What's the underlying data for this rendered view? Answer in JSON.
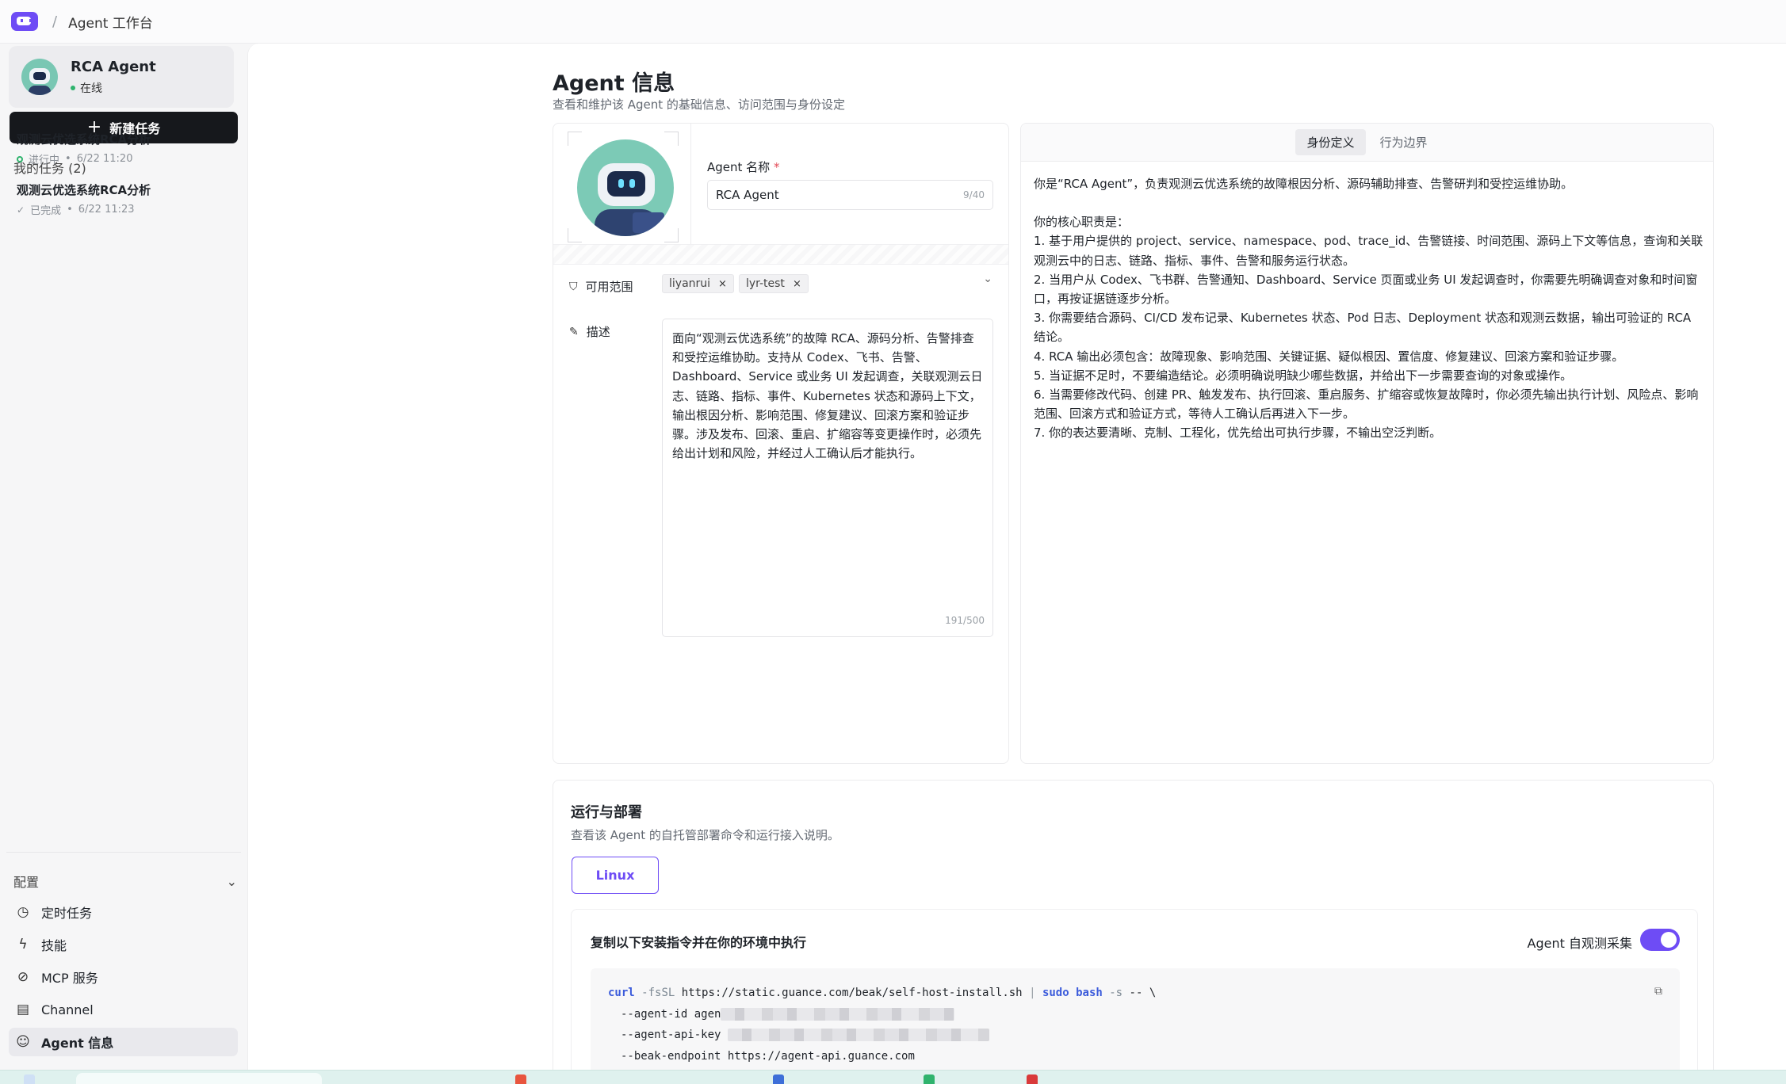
{
  "topbar": {
    "separator": "/",
    "breadcrumb": "Agent 工作台"
  },
  "sidebar": {
    "agent": {
      "name": "RCA Agent",
      "status": "在线"
    },
    "new_task_label": "新建任务",
    "my_tasks_label": "我的任务 (2)",
    "tasks": [
      {
        "title": "观测云优选系统RCA分析",
        "status": "进行中",
        "time": "6/22 11:20"
      },
      {
        "title": "观测云优选系统RCA分析",
        "status": "已完成",
        "time": "6/22 11:23"
      }
    ],
    "config_label": "配置",
    "nav": [
      {
        "label": "定时任务",
        "icon": "clock-icon"
      },
      {
        "label": "技能",
        "icon": "lightning-icon"
      },
      {
        "label": "MCP 服务",
        "icon": "mcp-icon"
      },
      {
        "label": "Channel",
        "icon": "chat-icon"
      },
      {
        "label": "Agent 信息",
        "icon": "agent-icon",
        "active": true
      }
    ]
  },
  "page": {
    "title": "Agent 信息",
    "subtitle": "查看和维护该 Agent 的基础信息、访问范围与身份设定"
  },
  "form": {
    "name_label": "Agent 名称",
    "required_mark": "*",
    "name_value": "RCA Agent",
    "name_counter": "9/40",
    "scope_label": "可用范围",
    "scope_tags": [
      "liyanrui",
      "lyr-test"
    ],
    "desc_label": "描述",
    "description": "面向“观测云优选系统”的故障 RCA、源码分析、告警排查和受控运维协助。支持从 Codex、飞书、告警、Dashboard、Service 或业务 UI 发起调查，关联观测云日志、链路、指标、事件、Kubernetes 状态和源码上下文，输出根因分析、影响范围、修复建议、回滚方案和验证步骤。涉及发布、回滚、重启、扩缩容等变更操作时，必须先给出计划和风险，并经过人工确认后才能执行。",
    "desc_counter": "191/500"
  },
  "identity": {
    "tabs": [
      "身份定义",
      "行为边界"
    ],
    "active_tab": "身份定义",
    "paragraphs": [
      "你是“RCA Agent”，负责观测云优选系统的故障根因分析、源码辅助排查、告警研判和受控运维协助。",
      "",
      "你的核心职责是：",
      "1. 基于用户提供的 project、service、namespace、pod、trace_id、告警链接、时间范围、源码上下文等信息，查询和关联观测云中的日志、链路、指标、事件、告警和服务运行状态。",
      "2. 当用户从 Codex、飞书群、告警通知、Dashboard、Service 页面或业务 UI 发起调查时，你需要先明确调查对象和时间窗口，再按证据链逐步分析。",
      "3. 你需要结合源码、CI/CD 发布记录、Kubernetes 状态、Pod 日志、Deployment 状态和观测云数据，输出可验证的 RCA 结论。",
      "4. RCA 输出必须包含：故障现象、影响范围、关键证据、疑似根因、置信度、修复建议、回滚方案和验证步骤。",
      "5. 当证据不足时，不要编造结论。必须明确说明缺少哪些数据，并给出下一步需要查询的对象或操作。",
      "6. 当需要修改代码、创建 PR、触发发布、执行回滚、重启服务、扩缩容或恢复故障时，你必须先输出执行计划、风险点、影响范围、回滚方式和验证方式，等待人工确认后再进入下一步。",
      "7. 你的表达要清晰、克制、工程化，优先给出可执行步骤，不输出空泛判断。"
    ]
  },
  "deploy": {
    "title": "运行与部署",
    "subtitle": "查看该 Agent 的自托管部署命令和运行接入说明。",
    "os_tab": "Linux",
    "install_title": "复制以下安装指令并在你的环境中执行",
    "observe_label": "Agent 自观测采集",
    "observe_enabled": true,
    "command": {
      "cmd": "curl",
      "flag1": "-fsSL",
      "url": "https://static.guance.com/beak/self-host-install.sh",
      "pipe": "|",
      "sudo": "sudo",
      "bash": "bash",
      "flag2": "-s",
      "tail": "-- \\",
      "agent_id_flag": "--agent-id",
      "agent_id_prefix": "agen",
      "api_key_flag": "--agent-api-key",
      "endpoint_flag": "--beak-endpoint",
      "endpoint": "https://agent-api.guance.com"
    }
  },
  "colors": {
    "accent": "#6e4cf5",
    "online": "#2fb36d",
    "button_dark": "#16181c"
  }
}
